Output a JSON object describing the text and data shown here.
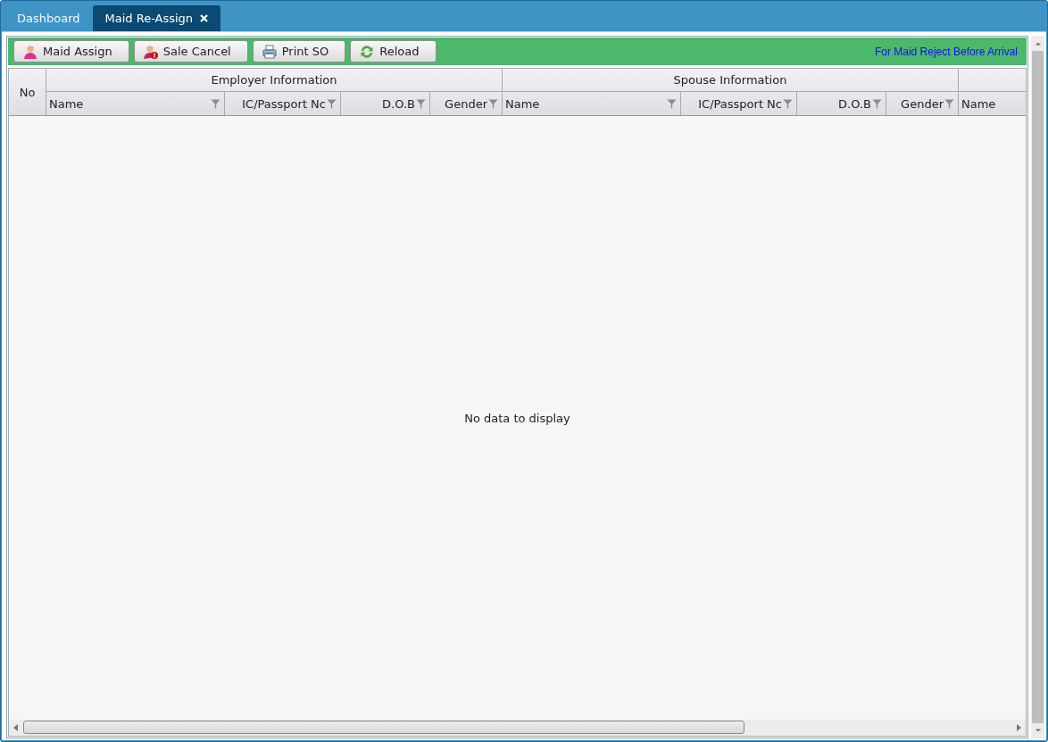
{
  "tabs": [
    {
      "label": "Dashboard",
      "selected": false,
      "closable": false
    },
    {
      "label": "Maid Re-Assign",
      "selected": true,
      "closable": true
    }
  ],
  "toolbar": {
    "buttons": [
      {
        "label": "Maid Assign",
        "kind": "person"
      },
      {
        "label": "Sale Cancel",
        "kind": "person-alert"
      },
      {
        "label": "Print SO",
        "kind": "printer"
      },
      {
        "label": "Reload",
        "kind": "reload"
      }
    ],
    "note": "For Maid Reject Before Arrival"
  },
  "table": {
    "no_column": "No",
    "groups": [
      {
        "title": "Employer Information",
        "columns": [
          {
            "label": "Name",
            "filter": true
          },
          {
            "label": "IC/Passport Nc",
            "filter": true
          },
          {
            "label": "D.O.B",
            "filter": true
          },
          {
            "label": "Gender",
            "filter": true
          }
        ]
      },
      {
        "title": "Spouse Information",
        "columns": [
          {
            "label": "Name",
            "filter": true
          },
          {
            "label": "IC/Passport Nc",
            "filter": true
          },
          {
            "label": "D.O.B",
            "filter": true
          },
          {
            "label": "Gender",
            "filter": true
          }
        ]
      },
      {
        "columns": [
          {
            "label": "Name",
            "filter": false
          }
        ]
      }
    ],
    "empty_text": "No data to display"
  }
}
